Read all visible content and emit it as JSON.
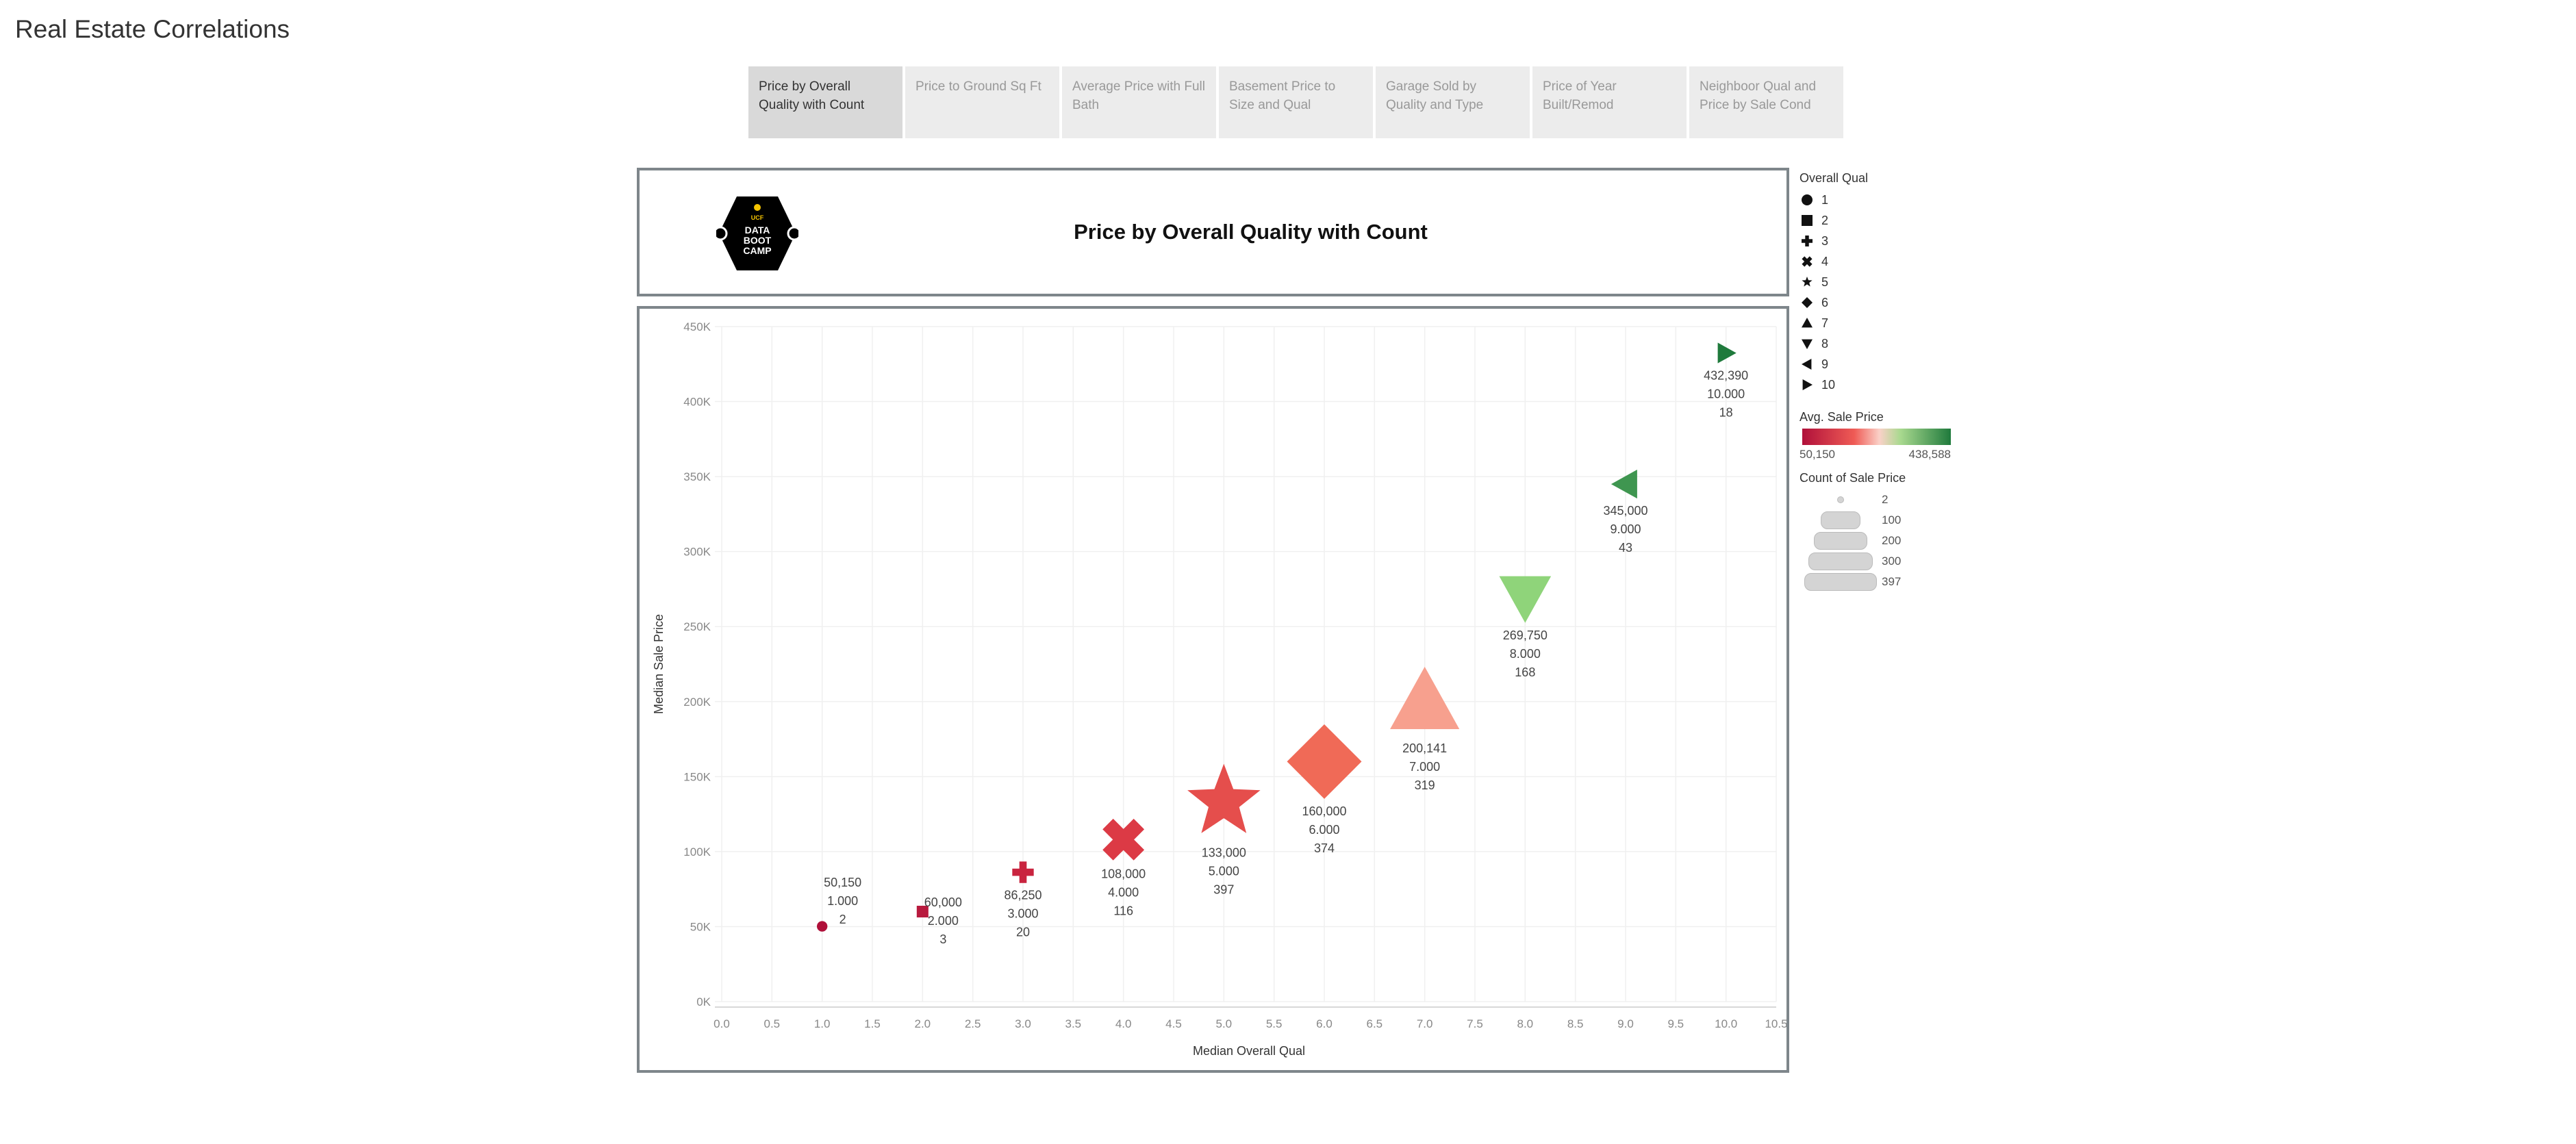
{
  "page": {
    "title": "Real Estate Correlations"
  },
  "tabs": [
    {
      "label": "Price by Overall Quality with Count",
      "active": true
    },
    {
      "label": "Price to Ground Sq Ft",
      "active": false
    },
    {
      "label": "Average Price with Full Bath",
      "active": false
    },
    {
      "label": "Basement Price to Size and Qual",
      "active": false
    },
    {
      "label": "Garage Sold by Quality and Type",
      "active": false
    },
    {
      "label": "Price of Year Built/Remod",
      "active": false
    },
    {
      "label": "Neighboor Qual and Price by Sale Cond",
      "active": false
    }
  ],
  "header": {
    "title": "Price by Overall Quality with Count",
    "logo": {
      "top": "UCF",
      "line1": "DATA",
      "line2": "BOOT",
      "line3": "CAMP"
    }
  },
  "legend": {
    "shape_title": "Overall Qual",
    "shapes": [
      {
        "label": "1",
        "shape": "circle"
      },
      {
        "label": "2",
        "shape": "square"
      },
      {
        "label": "3",
        "shape": "plus"
      },
      {
        "label": "4",
        "shape": "cross"
      },
      {
        "label": "5",
        "shape": "star"
      },
      {
        "label": "6",
        "shape": "diamond"
      },
      {
        "label": "7",
        "shape": "triangle-up"
      },
      {
        "label": "8",
        "shape": "triangle-down"
      },
      {
        "label": "9",
        "shape": "triangle-left"
      },
      {
        "label": "10",
        "shape": "triangle-right"
      }
    ],
    "color_title": "Avg. Sale Price",
    "color_min": "50,150",
    "color_max": "438,588",
    "size_title": "Count of Sale Price",
    "sizes": [
      "2",
      "100",
      "200",
      "300",
      "397"
    ]
  },
  "chart_data": {
    "type": "scatter",
    "xlabel": "Median Overall Qual",
    "ylabel": "Median Sale Price",
    "xlim": [
      0,
      10.5
    ],
    "ylim": [
      0,
      450000
    ],
    "x_ticks": [
      "0.0",
      "0.5",
      "1.0",
      "1.5",
      "2.0",
      "2.5",
      "3.0",
      "3.5",
      "4.0",
      "4.5",
      "5.0",
      "5.5",
      "6.0",
      "6.5",
      "7.0",
      "7.5",
      "8.0",
      "8.5",
      "9.0",
      "9.5",
      "10.0",
      "10.5"
    ],
    "y_ticks": [
      "0K",
      "50K",
      "100K",
      "150K",
      "200K",
      "250K",
      "300K",
      "350K",
      "400K",
      "450K"
    ],
    "grid": true,
    "points": [
      {
        "x": 1,
        "y": 50150,
        "count": 2,
        "shape": "circle",
        "color": "#b0103a",
        "labels": [
          "50,150",
          "1.000",
          "2"
        ]
      },
      {
        "x": 2,
        "y": 60000,
        "count": 3,
        "shape": "square",
        "color": "#b81a3e",
        "labels": [
          "60,000",
          "2.000",
          "3"
        ]
      },
      {
        "x": 3,
        "y": 86250,
        "count": 20,
        "shape": "plus",
        "color": "#c9243f",
        "labels": [
          "86,250",
          "3.000",
          "20"
        ]
      },
      {
        "x": 4,
        "y": 108000,
        "count": 116,
        "shape": "cross",
        "color": "#dc3a45",
        "labels": [
          "108,000",
          "4.000",
          "116"
        ]
      },
      {
        "x": 5,
        "y": 133000,
        "count": 397,
        "shape": "star",
        "color": "#e54e4c",
        "labels": [
          "133,000",
          "5.000",
          "397"
        ]
      },
      {
        "x": 6,
        "y": 160000,
        "count": 374,
        "shape": "diamond",
        "color": "#f06a57",
        "labels": [
          "160,000",
          "6.000",
          "374"
        ]
      },
      {
        "x": 7,
        "y": 200141,
        "count": 319,
        "shape": "triangle-up",
        "color": "#f7a08e",
        "labels": [
          "200,141",
          "7.000",
          "319"
        ]
      },
      {
        "x": 8,
        "y": 269750,
        "count": 168,
        "shape": "triangle-down",
        "color": "#8fd47a",
        "labels": [
          "269,750",
          "8.000",
          "168"
        ]
      },
      {
        "x": 9,
        "y": 345000,
        "count": 43,
        "shape": "triangle-left",
        "color": "#3f9650",
        "labels": [
          "345,000",
          "9.000",
          "43"
        ]
      },
      {
        "x": 10,
        "y": 432390,
        "count": 18,
        "shape": "triangle-right",
        "color": "#1f7a3c",
        "labels": [
          "432,390",
          "10.000",
          "18"
        ]
      }
    ]
  }
}
